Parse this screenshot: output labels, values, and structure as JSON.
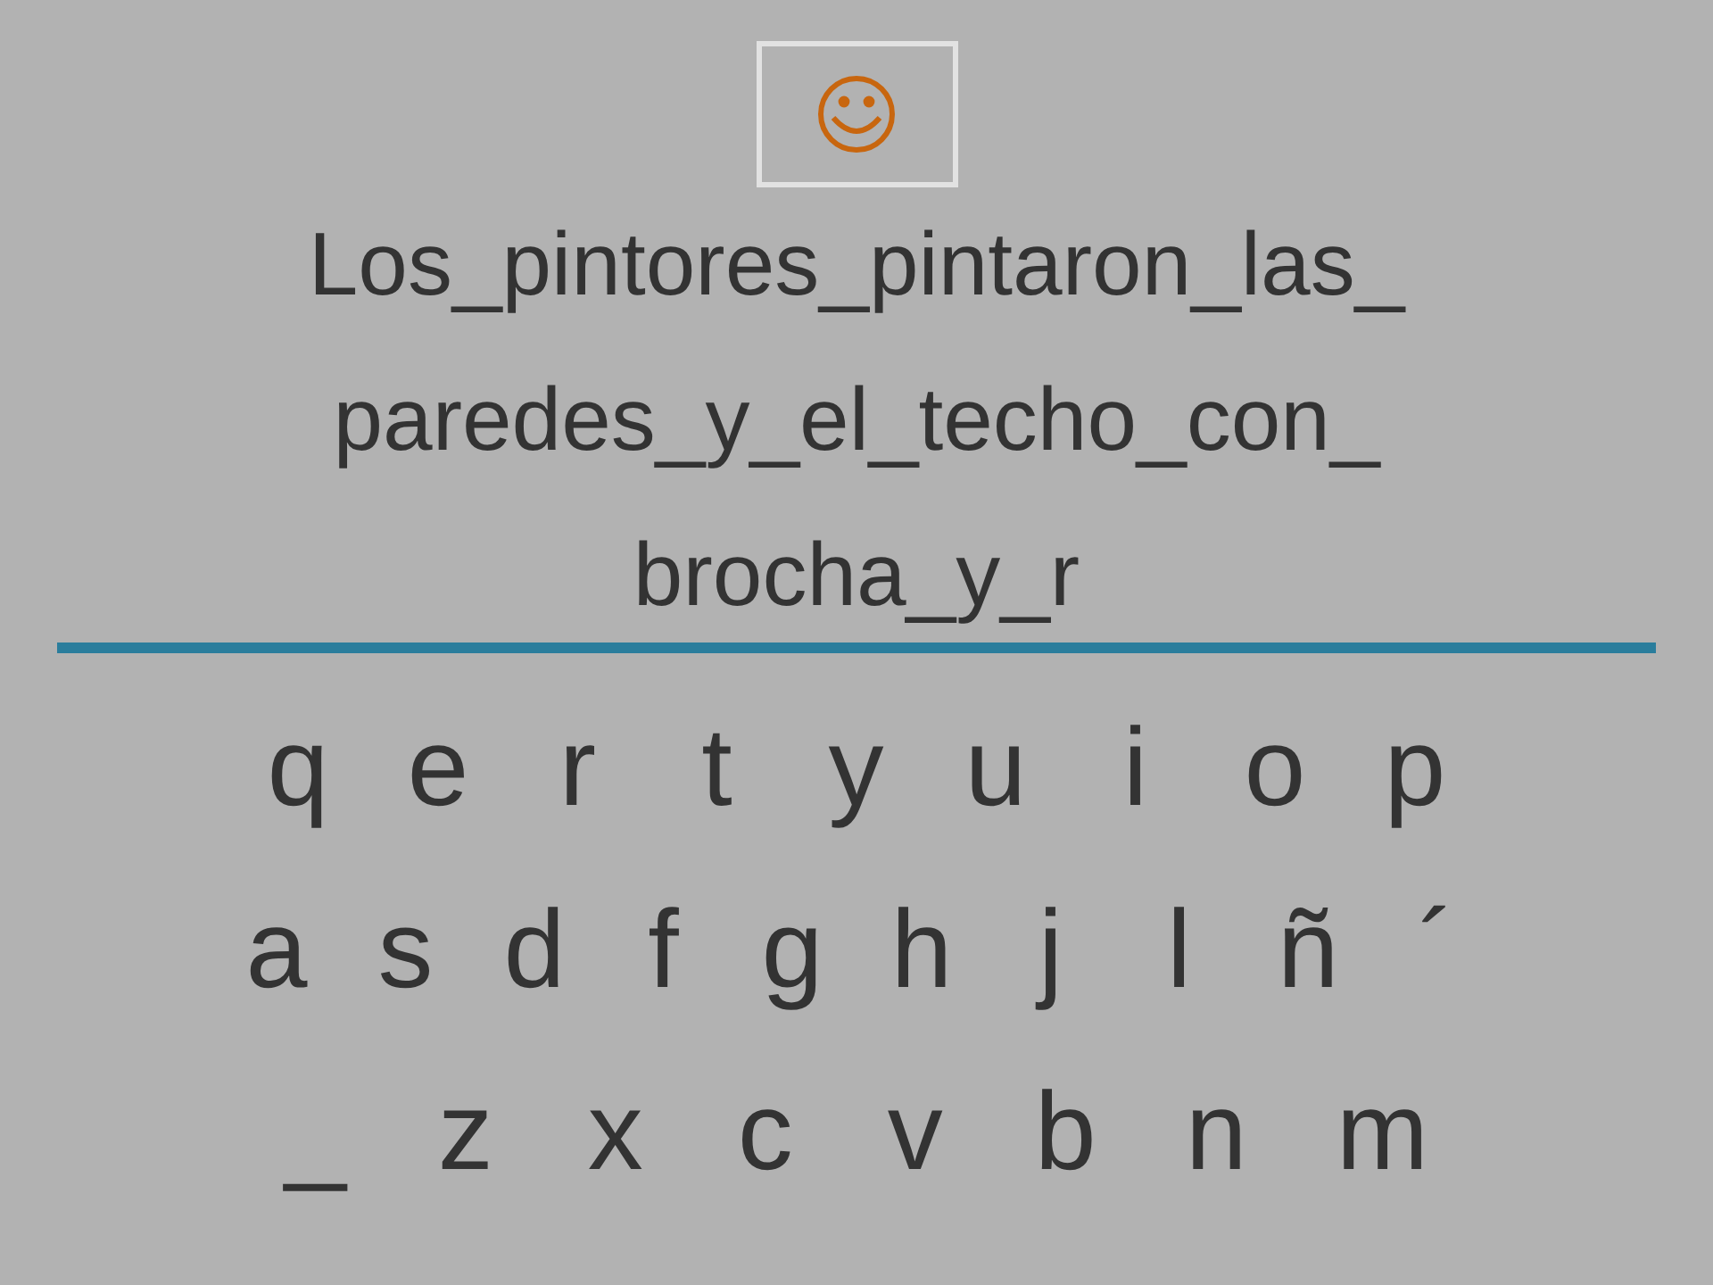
{
  "feedback": {
    "kind": "smiley"
  },
  "sentence_lines": [
    "Los_pintores_pintaron_las_",
    "paredes_y_el_techo_con_",
    "brocha_y_r"
  ],
  "keyboard_rows": [
    [
      "q",
      "e",
      "r",
      "t",
      "y",
      "u",
      "i",
      "o",
      "p"
    ],
    [
      "a",
      "s",
      "d",
      "f",
      "g",
      "h",
      "j",
      "l",
      "ñ",
      "´"
    ],
    [
      "_",
      "z",
      "x",
      "c",
      "v",
      "b",
      "n",
      "m"
    ]
  ]
}
